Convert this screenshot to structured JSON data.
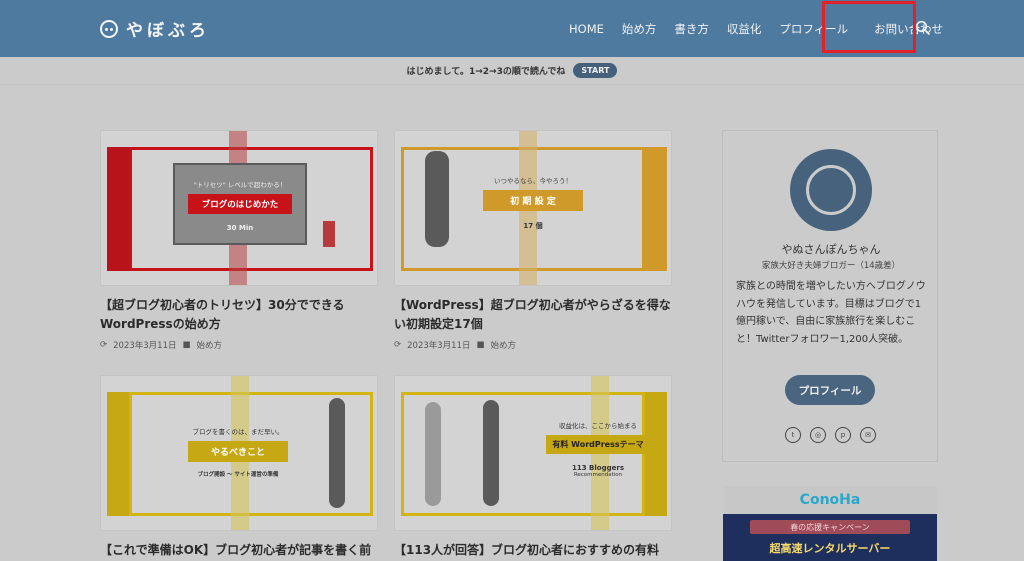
{
  "header": {
    "logo_text": "やぼぶろ",
    "nav": [
      "HOME",
      "始め方",
      "書き方",
      "収益化",
      "プロフィール",
      "お問い合わせ"
    ]
  },
  "notice": {
    "text": "はじめまして。1→2→3の順で読んでね",
    "button": "START"
  },
  "cards": [
    {
      "thumb_small": "\"トリセツ\" レベルで超わかる！",
      "thumb_label": "ブログのはじめかた",
      "thumb_sub": "30 Min",
      "title": "【超ブログ初心者のトリセツ】30分でできるWordPressの始め方",
      "date": "2023年3月11日",
      "category": "始め方"
    },
    {
      "thumb_small": "いつやるなら、今やろう！",
      "thumb_label": "初 期 設 定",
      "thumb_sub": "17 個",
      "title": "【WordPress】超ブログ初心者がやらざるを得ない初期設定17個",
      "date": "2023年3月11日",
      "category": "始め方"
    },
    {
      "thumb_small": "ブログを書くのは、まだ早い。",
      "thumb_label": "やるべきこと",
      "thumb_sub": "ブログ開設 〜 サイト運営の準備",
      "title": "【これで準備はOK】ブログ初心者が記事を書く前に",
      "date": "",
      "category": ""
    },
    {
      "thumb_small": "収益化は、ここから始まる",
      "thumb_label": "有料 WordPressテーマ",
      "thumb_sub": "113 Bloggers",
      "thumb_sub2": "Recommendation",
      "title": "【113人が回答】ブログ初心者におすすめの有料",
      "date": "",
      "category": ""
    }
  ],
  "profile": {
    "name": "やぬさんぽんちゃん",
    "subtitle": "家族大好き夫婦ブロガー（14歳差）",
    "description": "家族との時間を増やしたい方へブログノウハウを発信しています。目標はブログで1億円稼いで、自由に家族旅行を楽しむこと！Twitterフォロワー1,200人突破。",
    "button": "プロフィール"
  },
  "ad": {
    "logo": "ConoHa",
    "campaign": "春の応援キャンペーン",
    "headline": "超高速レンタルサーバー"
  },
  "colors": {
    "header": "#4f7aa0",
    "accent_red": "#c8121a",
    "accent_yellow": "#d2b514",
    "highlight": "#e2222a"
  }
}
